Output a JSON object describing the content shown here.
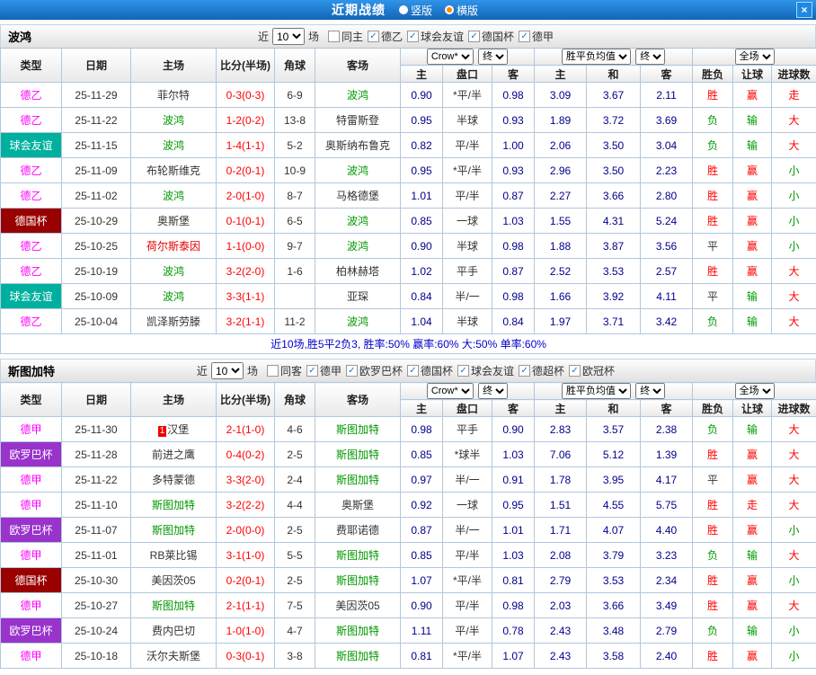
{
  "titlebar": {
    "title": "近期战绩",
    "vertical": "竖版",
    "horizontal": "横版",
    "close": "×"
  },
  "filter": {
    "near": "近",
    "count": "10",
    "games": "场"
  },
  "cols": {
    "type": "类型",
    "date": "日期",
    "home": "主场",
    "score": "比分(半场)",
    "corner": "角球",
    "away": "客场",
    "company": "Crow*",
    "final": "终",
    "h": "主",
    "hcp": "盘口",
    "a": "客",
    "europe": "胜平负均值",
    "draw": "和",
    "scope": "全场",
    "res": "胜负",
    "let": "让球",
    "goal": "进球数"
  },
  "colors": {
    "accent_blue": "#1976d2",
    "win_red": "#ff0000",
    "lose_green": "#009900",
    "team_green": "#009900",
    "league_magenta": "#ff00ff",
    "friendly_teal": "#00b09e",
    "cup_maroon": "#990000",
    "europa_purple": "#9933cc",
    "summary_blue": "#0000cc"
  },
  "sections": [
    {
      "team": "波鸿",
      "checkboxes": [
        {
          "label": "同主",
          "checked": false
        },
        {
          "label": "德乙",
          "checked": true
        },
        {
          "label": "球会友谊",
          "checked": true
        },
        {
          "label": "德国杯",
          "checked": true
        },
        {
          "label": "德甲",
          "checked": true
        }
      ],
      "rows": [
        {
          "lg": "德乙",
          "lf": "#ff00ff",
          "lb": "#ffffff",
          "d": "25-11-29",
          "h": "菲尔特",
          "hc": "k",
          "s": "0-3(0-3)",
          "c": "6-9",
          "a": "波鸿",
          "ac": "g",
          "o1": "0.90",
          "hp": "*平/半",
          "o2": "0.98",
          "e1": "3.09",
          "e2": "3.67",
          "e3": "2.11",
          "r1": "胜",
          "r1c": "r",
          "r2": "赢",
          "r2c": "r",
          "r3": "走",
          "r3c": "r"
        },
        {
          "lg": "德乙",
          "lf": "#ff00ff",
          "lb": "#ffffff",
          "d": "25-11-22",
          "h": "波鸿",
          "hc": "g",
          "s": "1-2(0-2)",
          "c": "13-8",
          "a": "特雷斯登",
          "ac": "k",
          "o1": "0.95",
          "hp": "半球",
          "o2": "0.93",
          "e1": "1.89",
          "e2": "3.72",
          "e3": "3.69",
          "r1": "负",
          "r1c": "g",
          "r2": "输",
          "r2c": "g",
          "r3": "大",
          "r3c": "r"
        },
        {
          "lg": "球会友谊",
          "lf": "#ffffff",
          "lb": "#00b09e",
          "d": "25-11-15",
          "h": "波鸿",
          "hc": "g",
          "s": "1-4(1-1)",
          "c": "5-2",
          "a": "奥斯纳布鲁克",
          "ac": "k",
          "o1": "0.82",
          "hp": "平/半",
          "o2": "1.00",
          "e1": "2.06",
          "e2": "3.50",
          "e3": "3.04",
          "r1": "负",
          "r1c": "g",
          "r2": "输",
          "r2c": "g",
          "r3": "大",
          "r3c": "r"
        },
        {
          "lg": "德乙",
          "lf": "#ff00ff",
          "lb": "#ffffff",
          "d": "25-11-09",
          "h": "布轮斯维克",
          "hc": "k",
          "s": "0-2(0-1)",
          "c": "10-9",
          "a": "波鸿",
          "ac": "g",
          "o1": "0.95",
          "hp": "*平/半",
          "o2": "0.93",
          "e1": "2.96",
          "e2": "3.50",
          "e3": "2.23",
          "r1": "胜",
          "r1c": "r",
          "r2": "赢",
          "r2c": "r",
          "r3": "小",
          "r3c": "g"
        },
        {
          "lg": "德乙",
          "lf": "#ff00ff",
          "lb": "#ffffff",
          "d": "25-11-02",
          "h": "波鸿",
          "hc": "g",
          "s": "2-0(1-0)",
          "c": "8-7",
          "a": "马格德堡",
          "ac": "k",
          "o1": "1.01",
          "hp": "平/半",
          "o2": "0.87",
          "e1": "2.27",
          "e2": "3.66",
          "e3": "2.80",
          "r1": "胜",
          "r1c": "r",
          "r2": "赢",
          "r2c": "r",
          "r3": "小",
          "r3c": "g"
        },
        {
          "lg": "德国杯",
          "lf": "#ffffff",
          "lb": "#990000",
          "d": "25-10-29",
          "h": "奥斯堡",
          "hc": "k",
          "s": "0-1(0-1)",
          "c": "6-5",
          "a": "波鸿",
          "ac": "g",
          "o1": "0.85",
          "hp": "一球",
          "o2": "1.03",
          "e1": "1.55",
          "e2": "4.31",
          "e3": "5.24",
          "r1": "胜",
          "r1c": "r",
          "r2": "赢",
          "r2c": "r",
          "r3": "小",
          "r3c": "g"
        },
        {
          "lg": "德乙",
          "lf": "#ff00ff",
          "lb": "#ffffff",
          "d": "25-10-25",
          "h": "荷尔斯泰因",
          "hc": "r",
          "s": "1-1(0-0)",
          "c": "9-7",
          "a": "波鸿",
          "ac": "g",
          "o1": "0.90",
          "hp": "半球",
          "o2": "0.98",
          "e1": "1.88",
          "e2": "3.87",
          "e3": "3.56",
          "r1": "平",
          "r1c": "k",
          "r2": "赢",
          "r2c": "r",
          "r3": "小",
          "r3c": "g"
        },
        {
          "lg": "德乙",
          "lf": "#ff00ff",
          "lb": "#ffffff",
          "d": "25-10-19",
          "h": "波鸿",
          "hc": "g",
          "s": "3-2(2-0)",
          "c": "1-6",
          "a": "柏林赫塔",
          "ac": "k",
          "o1": "1.02",
          "hp": "平手",
          "o2": "0.87",
          "e1": "2.52",
          "e2": "3.53",
          "e3": "2.57",
          "r1": "胜",
          "r1c": "r",
          "r2": "赢",
          "r2c": "r",
          "r3": "大",
          "r3c": "r"
        },
        {
          "lg": "球会友谊",
          "lf": "#ffffff",
          "lb": "#00b09e",
          "d": "25-10-09",
          "h": "波鸿",
          "hc": "g",
          "s": "3-3(1-1)",
          "c": "",
          "a": "亚琛",
          "ac": "k",
          "o1": "0.84",
          "hp": "半/一",
          "o2": "0.98",
          "e1": "1.66",
          "e2": "3.92",
          "e3": "4.11",
          "r1": "平",
          "r1c": "k",
          "r2": "输",
          "r2c": "g",
          "r3": "大",
          "r3c": "r"
        },
        {
          "lg": "德乙",
          "lf": "#ff00ff",
          "lb": "#ffffff",
          "d": "25-10-04",
          "h": "凯泽斯劳滕",
          "hc": "k",
          "s": "3-2(1-1)",
          "c": "11-2",
          "a": "波鸿",
          "ac": "g",
          "o1": "1.04",
          "hp": "半球",
          "o2": "0.84",
          "e1": "1.97",
          "e2": "3.71",
          "e3": "3.42",
          "r1": "负",
          "r1c": "g",
          "r2": "输",
          "r2c": "g",
          "r3": "大",
          "r3c": "r"
        }
      ],
      "summary": "近10场,胜5平2负3, 胜率:50% 赢率:60% 大:50% 单率:60%"
    },
    {
      "team": "斯图加特",
      "checkboxes": [
        {
          "label": "同客",
          "checked": false
        },
        {
          "label": "德甲",
          "checked": true
        },
        {
          "label": "欧罗巴杯",
          "checked": true
        },
        {
          "label": "德国杯",
          "checked": true
        },
        {
          "label": "球会友谊",
          "checked": true
        },
        {
          "label": "德超杯",
          "checked": true
        },
        {
          "label": "欧冠杯",
          "checked": true
        }
      ],
      "rows": [
        {
          "lg": "德甲",
          "lf": "#ff00ff",
          "lb": "#ffffff",
          "d": "25-11-30",
          "h": "汉堡",
          "hb": "1",
          "hc": "k",
          "s": "2-1(1-0)",
          "c": "4-6",
          "a": "斯图加特",
          "ac": "g",
          "o1": "0.98",
          "hp": "平手",
          "o2": "0.90",
          "e1": "2.83",
          "e2": "3.57",
          "e3": "2.38",
          "r1": "负",
          "r1c": "g",
          "r2": "输",
          "r2c": "g",
          "r3": "大",
          "r3c": "r"
        },
        {
          "lg": "欧罗巴杯",
          "lf": "#ffffff",
          "lb": "#9933cc",
          "d": "25-11-28",
          "h": "前进之鹰",
          "hc": "k",
          "s": "0-4(0-2)",
          "c": "2-5",
          "a": "斯图加特",
          "ac": "g",
          "o1": "0.85",
          "hp": "*球半",
          "o2": "1.03",
          "e1": "7.06",
          "e2": "5.12",
          "e3": "1.39",
          "r1": "胜",
          "r1c": "r",
          "r2": "赢",
          "r2c": "r",
          "r3": "大",
          "r3c": "r"
        },
        {
          "lg": "德甲",
          "lf": "#ff00ff",
          "lb": "#ffffff",
          "d": "25-11-22",
          "h": "多特蒙德",
          "hc": "k",
          "s": "3-3(2-0)",
          "c": "2-4",
          "a": "斯图加特",
          "ac": "g",
          "o1": "0.97",
          "hp": "半/一",
          "o2": "0.91",
          "e1": "1.78",
          "e2": "3.95",
          "e3": "4.17",
          "r1": "平",
          "r1c": "k",
          "r2": "赢",
          "r2c": "r",
          "r3": "大",
          "r3c": "r"
        },
        {
          "lg": "德甲",
          "lf": "#ff00ff",
          "lb": "#ffffff",
          "d": "25-11-10",
          "h": "斯图加特",
          "hc": "g",
          "s": "3-2(2-2)",
          "c": "4-4",
          "a": "奥斯堡",
          "ac": "k",
          "o1": "0.92",
          "hp": "一球",
          "o2": "0.95",
          "e1": "1.51",
          "e2": "4.55",
          "e3": "5.75",
          "r1": "胜",
          "r1c": "r",
          "r2": "走",
          "r2c": "r",
          "r3": "大",
          "r3c": "r"
        },
        {
          "lg": "欧罗巴杯",
          "lf": "#ffffff",
          "lb": "#9933cc",
          "d": "25-11-07",
          "h": "斯图加特",
          "hc": "g",
          "s": "2-0(0-0)",
          "c": "2-5",
          "a": "费耶诺德",
          "ac": "k",
          "o1": "0.87",
          "hp": "半/一",
          "o2": "1.01",
          "e1": "1.71",
          "e2": "4.07",
          "e3": "4.40",
          "r1": "胜",
          "r1c": "r",
          "r2": "赢",
          "r2c": "r",
          "r3": "小",
          "r3c": "g"
        },
        {
          "lg": "德甲",
          "lf": "#ff00ff",
          "lb": "#ffffff",
          "d": "25-11-01",
          "h": "RB莱比锡",
          "hc": "k",
          "s": "3-1(1-0)",
          "c": "5-5",
          "a": "斯图加特",
          "ac": "g",
          "o1": "0.85",
          "hp": "平/半",
          "o2": "1.03",
          "e1": "2.08",
          "e2": "3.79",
          "e3": "3.23",
          "r1": "负",
          "r1c": "g",
          "r2": "输",
          "r2c": "g",
          "r3": "大",
          "r3c": "r"
        },
        {
          "lg": "德国杯",
          "lf": "#ffffff",
          "lb": "#990000",
          "d": "25-10-30",
          "h": "美因茨05",
          "hc": "k",
          "s": "0-2(0-1)",
          "c": "2-5",
          "a": "斯图加特",
          "ac": "g",
          "o1": "1.07",
          "hp": "*平/半",
          "o2": "0.81",
          "e1": "2.79",
          "e2": "3.53",
          "e3": "2.34",
          "r1": "胜",
          "r1c": "r",
          "r2": "赢",
          "r2c": "r",
          "r3": "小",
          "r3c": "g"
        },
        {
          "lg": "德甲",
          "lf": "#ff00ff",
          "lb": "#ffffff",
          "d": "25-10-27",
          "h": "斯图加特",
          "hc": "g",
          "s": "2-1(1-1)",
          "c": "7-5",
          "a": "美因茨05",
          "ac": "k",
          "o1": "0.90",
          "hp": "平/半",
          "o2": "0.98",
          "e1": "2.03",
          "e2": "3.66",
          "e3": "3.49",
          "r1": "胜",
          "r1c": "r",
          "r2": "赢",
          "r2c": "r",
          "r3": "大",
          "r3c": "r"
        },
        {
          "lg": "欧罗巴杯",
          "lf": "#ffffff",
          "lb": "#9933cc",
          "d": "25-10-24",
          "h": "费内巴切",
          "hc": "k",
          "s": "1-0(1-0)",
          "c": "4-7",
          "a": "斯图加特",
          "ac": "g",
          "o1": "1.11",
          "hp": "平/半",
          "o2": "0.78",
          "e1": "2.43",
          "e2": "3.48",
          "e3": "2.79",
          "r1": "负",
          "r1c": "g",
          "r2": "输",
          "r2c": "g",
          "r3": "小",
          "r3c": "g"
        },
        {
          "lg": "德甲",
          "lf": "#ff00ff",
          "lb": "#ffffff",
          "d": "25-10-18",
          "h": "沃尔夫斯堡",
          "hc": "k",
          "s": "0-3(0-1)",
          "c": "3-8",
          "a": "斯图加特",
          "ac": "g",
          "o1": "0.81",
          "hp": "*平/半",
          "o2": "1.07",
          "e1": "2.43",
          "e2": "3.58",
          "e3": "2.40",
          "r1": "胜",
          "r1c": "r",
          "r2": "赢",
          "r2c": "r",
          "r3": "小",
          "r3c": "g"
        }
      ],
      "summary": ""
    }
  ]
}
